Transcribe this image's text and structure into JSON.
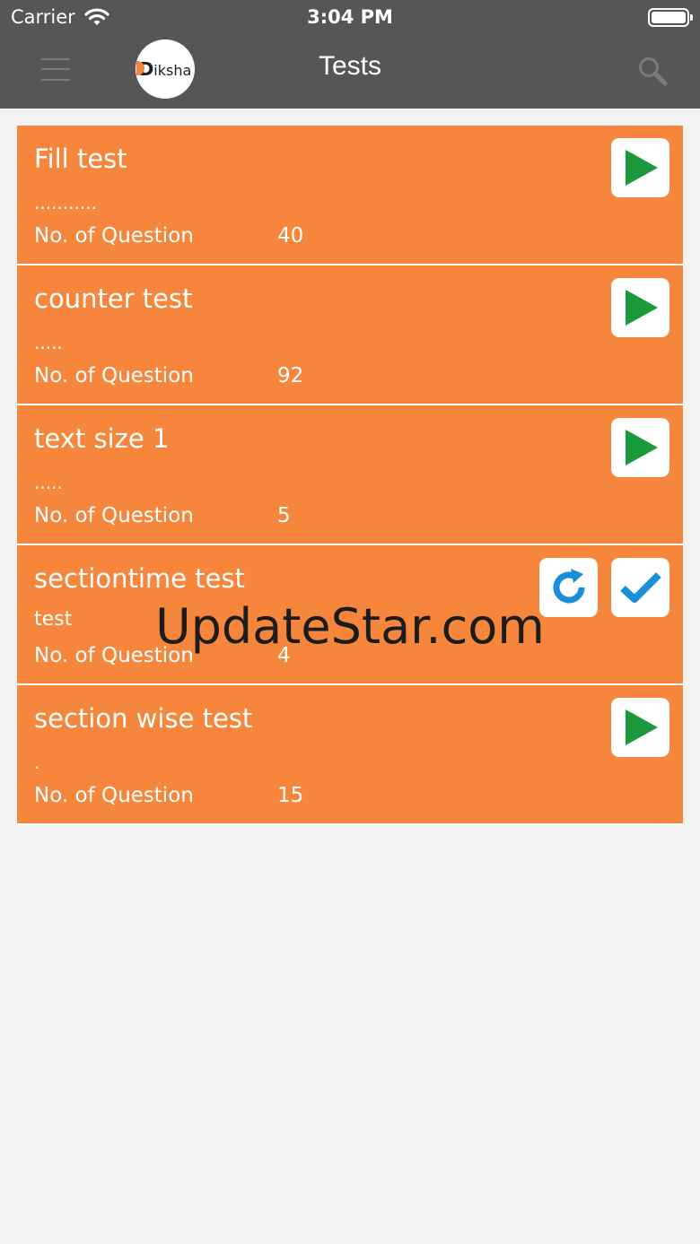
{
  "status_bar": {
    "carrier": "Carrier",
    "time": "3:04 PM"
  },
  "header": {
    "title": "Tests",
    "logo_text": "iksha",
    "logo_letter": "D"
  },
  "tests": [
    {
      "title": "Fill test",
      "description": "...........",
      "question_label": "No. of Question",
      "question_count": "40",
      "state": "play"
    },
    {
      "title": "counter test",
      "description": ".....",
      "question_label": "No. of Question",
      "question_count": "92",
      "state": "play"
    },
    {
      "title": "text size 1",
      "description": ".....",
      "question_label": "No. of Question",
      "question_count": "5",
      "state": "play"
    },
    {
      "title": "sectiontime test",
      "description": "test",
      "question_label": "No. of Question",
      "question_count": "4",
      "state": "completed"
    },
    {
      "title": "section wise test",
      "description": ".",
      "question_label": "No. of Question",
      "question_count": "15",
      "state": "play"
    }
  ],
  "icons": {
    "play": "play-icon",
    "retake": "refresh-icon",
    "completed": "checkmark-icon",
    "menu": "hamburger-menu-icon",
    "search": "search-icon"
  },
  "colors": {
    "card": "#f5863b",
    "topbar": "#565656",
    "play": "#1a9a3a",
    "check": "#1a8fd8"
  },
  "watermark": "UpdateStar.com"
}
